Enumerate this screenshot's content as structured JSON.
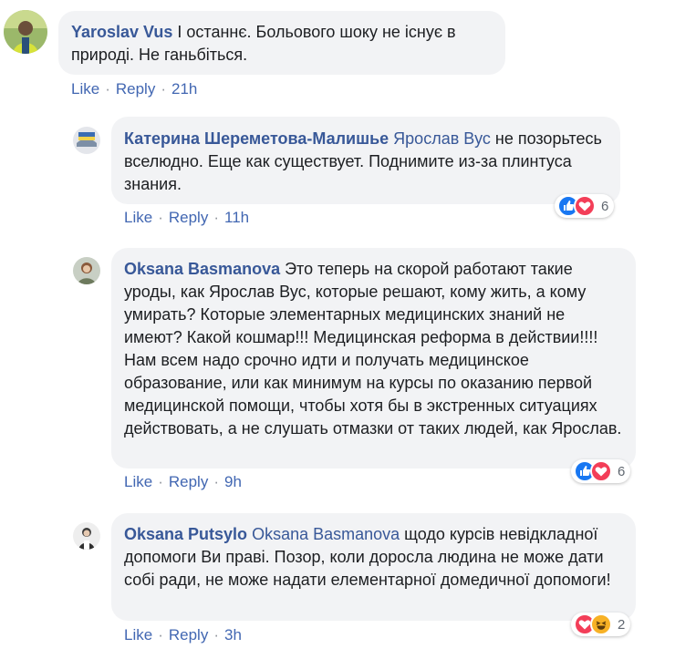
{
  "comments": [
    {
      "author": "Yaroslav Vus",
      "mention": "",
      "text": " І останнє. Больового шоку не існує в природі. Не ганьбіться.",
      "actions": {
        "like": "Like",
        "reply": "Reply",
        "time": "21h"
      },
      "reactions": null
    },
    {
      "author": "Катерина Шереметова-Малишье",
      "mention": "Ярослав Вус",
      "text": " не позорьтесь вселюдно. Еще как существует. Поднимите из-за плинтуса знания.",
      "actions": {
        "like": "Like",
        "reply": "Reply",
        "time": "11h"
      },
      "reactions": {
        "icons": [
          "like-icon",
          "love-icon"
        ],
        "count": "6"
      }
    },
    {
      "author": "Oksana Basmanova",
      "mention": "",
      "text": " Это теперь на скорой работают такие уроды, как Ярослав Вус, которые решают, кому жить, а кому умирать? Которые элементарных медицинских знаний не имеют? Какой кошмар!!! Медицинская реформа в действии!!!! Нам всем надо срочно идти и получать медицинское образование, или как минимум на курсы по оказанию первой медицинской помощи, чтобы хотя бы в экстренных ситуациях действовать, а не слушать отмазки от таких людей, как Ярослав.",
      "actions": {
        "like": "Like",
        "reply": "Reply",
        "time": "9h"
      },
      "reactions": {
        "icons": [
          "like-icon",
          "love-icon"
        ],
        "count": "6"
      }
    },
    {
      "author": "Oksana Putsylo",
      "mention": "Oksana Basmanova",
      "text": " щодо курсів невідкладної допомоги Ви праві. Позор, коли доросла людина не може дати собі ради, не може надати елементарної домедичної допомоги!",
      "actions": {
        "like": "Like",
        "reply": "Reply",
        "time": "3h"
      },
      "reactions": {
        "icons": [
          "love-icon",
          "haha-icon"
        ],
        "count": "2"
      }
    }
  ],
  "colors": {
    "link": "#385898",
    "bubble": "#f2f3f5",
    "like": "#1877f2",
    "love": "#f33e58",
    "haha": "#f7b125"
  }
}
